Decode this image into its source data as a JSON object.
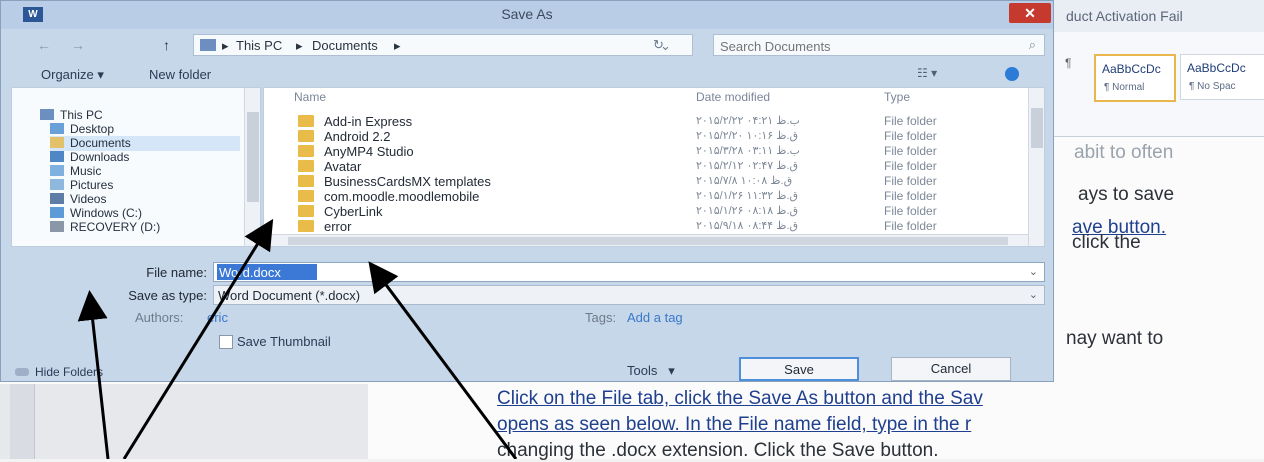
{
  "word": {
    "title": "duct Activation Fail",
    "style_normal": {
      "sample": "AaBbCcDc",
      "name": "¶ Normal"
    },
    "style_nospacing": {
      "sample": "AaBbCcDc",
      "name": "¶ No Spac"
    },
    "ribbon_mark": "¶",
    "side_lines": [
      "ays to save",
      "ave button.",
      "click the",
      "nay want to"
    ],
    "side_fragment_top": "abit to often",
    "body_lines": [
      "Click on the File tab, click the Save As button and the Sav",
      "opens as seen below. In the File name field, type in the r",
      "changing the .docx extension. Click the Save button."
    ]
  },
  "dialog": {
    "title": "Save As",
    "close_label": "✕",
    "app_icon_label": "W",
    "nav": {
      "back": "←",
      "forward": "→",
      "up": "↑"
    },
    "breadcrumb": [
      "This PC",
      "Documents"
    ],
    "search_placeholder": "Search Documents",
    "toolbar": {
      "organize": "Organize ▾",
      "new_folder": "New folder",
      "view": "☷ ▾"
    },
    "nav_pane": [
      {
        "label": "This PC",
        "icon": "computer-icon",
        "color": "#6c8fbf"
      },
      {
        "label": "Desktop",
        "icon": "desktop-icon",
        "color": "#6aa0d8"
      },
      {
        "label": "Documents",
        "icon": "documents-icon",
        "color": "#e3c06a"
      },
      {
        "label": "Downloads",
        "icon": "downloads-icon",
        "color": "#4f86c6"
      },
      {
        "label": "Music",
        "icon": "music-icon",
        "color": "#7fb1e0"
      },
      {
        "label": "Pictures",
        "icon": "pictures-icon",
        "color": "#8fb8df"
      },
      {
        "label": "Videos",
        "icon": "videos-icon",
        "color": "#5d7ca6"
      },
      {
        "label": "Windows (C:)",
        "icon": "drive-icon",
        "color": "#5c9bd8"
      },
      {
        "label": "RECOVERY (D:)",
        "icon": "drive-icon",
        "color": "#8a97a8"
      }
    ],
    "columns": {
      "name": "Name",
      "date": "Date modified",
      "type": "Type"
    },
    "files": [
      {
        "name": "Add-in Express",
        "date": "۲۰۱۵/۲/۲۲ ب.ظ ۰۴:۲۱",
        "type": "File folder"
      },
      {
        "name": "Android 2.2",
        "date": "۲۰۱۵/۲/۲۰ ق.ظ ۱۰:۱۶",
        "type": "File folder"
      },
      {
        "name": "AnyMP4 Studio",
        "date": "۲۰۱۵/۳/۲۸ ب.ظ ۰۳:۱۱",
        "type": "File folder"
      },
      {
        "name": "Avatar",
        "date": "۲۰۱۵/۲/۱۲ ق.ظ ۰۲:۴۷",
        "type": "File folder"
      },
      {
        "name": "BusinessCardsMX templates",
        "date": "۲۰۱۵/۷/۸ ق.ظ ۱۰:۰۸",
        "type": "File folder"
      },
      {
        "name": "com.moodle.moodlemobile",
        "date": "۲۰۱۵/۱/۲۶ ق.ظ ۱۱:۳۲",
        "type": "File folder"
      },
      {
        "name": "CyberLink",
        "date": "۲۰۱۵/۱/۲۶ ق.ظ ۰۸:۱۸",
        "type": "File folder"
      },
      {
        "name": "error",
        "date": "۲۰۱۵/۹/۱۸ ق.ظ ۰۸:۴۴",
        "type": "File folder"
      }
    ],
    "file_name_label": "File name:",
    "file_name_value": "Word.docx",
    "save_type_label": "Save as type:",
    "save_type_value": "Word Document (*.docx)",
    "authors_label": "Authors:",
    "authors_value": "eric",
    "tags_label": "Tags:",
    "tags_value": "Add a tag",
    "thumbnail_label": "Save Thumbnail",
    "hide_folders": "Hide Folders",
    "tools": "Tools",
    "tools_caret": "▾",
    "save": "Save",
    "cancel": "Cancel",
    "dropdown_glyph": "⌄"
  },
  "colors": {
    "accent": "#3c79d6",
    "close": "#c6392f",
    "folder": "#e9bc4a"
  }
}
